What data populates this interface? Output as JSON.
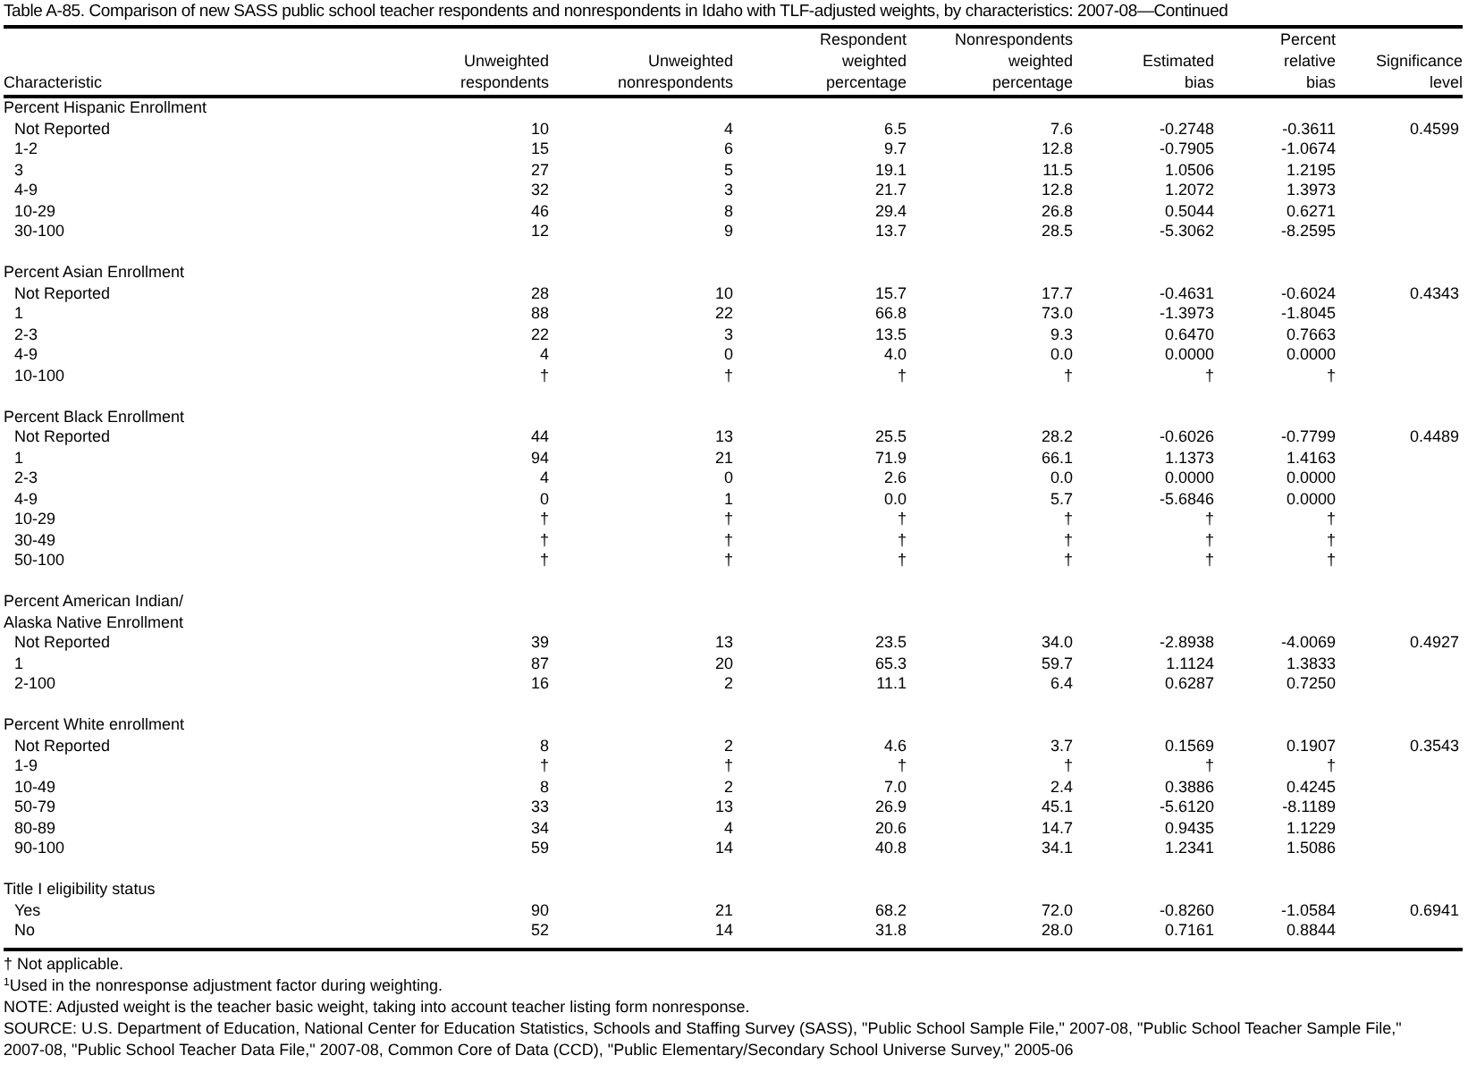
{
  "title": "Table A-85. Comparison of new SASS public school teacher respondents and nonrespondents in Idaho with TLF-adjusted weights, by characteristics: 2007-08—Continued",
  "columns": [
    {
      "lines": [
        "Characteristic"
      ]
    },
    {
      "lines": [
        "Unweighted",
        "respondents"
      ]
    },
    {
      "lines": [
        "Unweighted",
        "nonrespondents"
      ]
    },
    {
      "lines": [
        "Respondent",
        "weighted",
        "percentage"
      ]
    },
    {
      "lines": [
        "Nonrespondents",
        "weighted",
        "percentage"
      ]
    },
    {
      "lines": [
        "Estimated",
        "bias"
      ]
    },
    {
      "lines": [
        "Percent",
        "relative",
        "bias"
      ]
    },
    {
      "lines": [
        "Significance",
        "level"
      ]
    }
  ],
  "groups": [
    {
      "label": [
        "Percent Hispanic Enrollment"
      ],
      "rows": [
        {
          "label": "Not Reported",
          "values": [
            "10",
            "4",
            "6.5",
            "7.6",
            "-0.2748",
            "-0.3611"
          ],
          "significance": "0.4599"
        },
        {
          "label": "1-2",
          "values": [
            "15",
            "6",
            "9.7",
            "12.8",
            "-0.7905",
            "-1.0674"
          ]
        },
        {
          "label": "3",
          "values": [
            "27",
            "5",
            "19.1",
            "11.5",
            "1.0506",
            "1.2195"
          ]
        },
        {
          "label": "4-9",
          "values": [
            "32",
            "3",
            "21.7",
            "12.8",
            "1.2072",
            "1.3973"
          ]
        },
        {
          "label": "10-29",
          "values": [
            "46",
            "8",
            "29.4",
            "26.8",
            "0.5044",
            "0.6271"
          ]
        },
        {
          "label": "30-100",
          "values": [
            "12",
            "9",
            "13.7",
            "28.5",
            "-5.3062",
            "-8.2595"
          ]
        }
      ]
    },
    {
      "label": [
        "Percent Asian Enrollment"
      ],
      "rows": [
        {
          "label": "Not Reported",
          "values": [
            "28",
            "10",
            "15.7",
            "17.7",
            "-0.4631",
            "-0.6024"
          ],
          "significance": "0.4343"
        },
        {
          "label": "1",
          "values": [
            "88",
            "22",
            "66.8",
            "73.0",
            "-1.3973",
            "-1.8045"
          ]
        },
        {
          "label": "2-3",
          "values": [
            "22",
            "3",
            "13.5",
            "9.3",
            "0.6470",
            "0.7663"
          ]
        },
        {
          "label": "4-9",
          "values": [
            "4",
            "0",
            "4.0",
            "0.0",
            "0.0000",
            "0.0000"
          ]
        },
        {
          "label": "10-100",
          "values": [
            "†",
            "†",
            "†",
            "†",
            "†",
            "†"
          ]
        }
      ]
    },
    {
      "label": [
        "Percent Black Enrollment"
      ],
      "rows": [
        {
          "label": "Not Reported",
          "values": [
            "44",
            "13",
            "25.5",
            "28.2",
            "-0.6026",
            "-0.7799"
          ],
          "significance": "0.4489"
        },
        {
          "label": "1",
          "values": [
            "94",
            "21",
            "71.9",
            "66.1",
            "1.1373",
            "1.4163"
          ]
        },
        {
          "label": "2-3",
          "values": [
            "4",
            "0",
            "2.6",
            "0.0",
            "0.0000",
            "0.0000"
          ]
        },
        {
          "label": "4-9",
          "values": [
            "0",
            "1",
            "0.0",
            "5.7",
            "-5.6846",
            "0.0000"
          ]
        },
        {
          "label": "10-29",
          "values": [
            "†",
            "†",
            "†",
            "†",
            "†",
            "†"
          ]
        },
        {
          "label": "30-49",
          "values": [
            "†",
            "†",
            "†",
            "†",
            "†",
            "†"
          ]
        },
        {
          "label": "50-100",
          "values": [
            "†",
            "†",
            "†",
            "†",
            "†",
            "†"
          ]
        }
      ]
    },
    {
      "label": [
        "Percent American Indian/",
        "Alaska Native Enrollment"
      ],
      "rows": [
        {
          "label": "Not Reported",
          "values": [
            "39",
            "13",
            "23.5",
            "34.0",
            "-2.8938",
            "-4.0069"
          ],
          "significance": "0.4927"
        },
        {
          "label": "1",
          "values": [
            "87",
            "20",
            "65.3",
            "59.7",
            "1.1124",
            "1.3833"
          ]
        },
        {
          "label": "2-100",
          "values": [
            "16",
            "2",
            "11.1",
            "6.4",
            "0.6287",
            "0.7250"
          ]
        }
      ]
    },
    {
      "label": [
        "Percent White enrollment"
      ],
      "rows": [
        {
          "label": "Not Reported",
          "values": [
            "8",
            "2",
            "4.6",
            "3.7",
            "0.1569",
            "0.1907"
          ],
          "significance": "0.3543"
        },
        {
          "label": "1-9",
          "values": [
            "†",
            "†",
            "†",
            "†",
            "†",
            "†"
          ]
        },
        {
          "label": "10-49",
          "values": [
            "8",
            "2",
            "7.0",
            "2.4",
            "0.3886",
            "0.4245"
          ]
        },
        {
          "label": "50-79",
          "values": [
            "33",
            "13",
            "26.9",
            "45.1",
            "-5.6120",
            "-8.1189"
          ]
        },
        {
          "label": "80-89",
          "values": [
            "34",
            "4",
            "20.6",
            "14.7",
            "0.9435",
            "1.1229"
          ]
        },
        {
          "label": "90-100",
          "values": [
            "59",
            "14",
            "40.8",
            "34.1",
            "1.2341",
            "1.5086"
          ]
        }
      ]
    },
    {
      "label": [
        "Title I eligibility status"
      ],
      "rows": [
        {
          "label": "Yes",
          "values": [
            "90",
            "21",
            "68.2",
            "72.0",
            "-0.8260",
            "-1.0584"
          ],
          "significance": "0.6941"
        },
        {
          "label": "No",
          "values": [
            "52",
            "14",
            "31.8",
            "28.0",
            "0.7161",
            "0.8844"
          ]
        }
      ]
    }
  ],
  "notes": [
    "† Not applicable.",
    "$^{1}$Used in the nonresponse adjustment factor during weighting.",
    "NOTE: Adjusted weight is the teacher basic weight, taking into account teacher listing form nonresponse.",
    "SOURCE: U.S. Department of Education, National Center for Education Statistics, Schools and Staffing Survey (SASS), \"Public School Sample File,\" 2007-08, \"Public School Teacher Sample File,\" 2007-08, \"Public School Teacher Data File,\" 2007-08, Common Core of Data (CCD), \"Public Elementary/Secondary School Universe Survey,\" 2005-06"
  ]
}
